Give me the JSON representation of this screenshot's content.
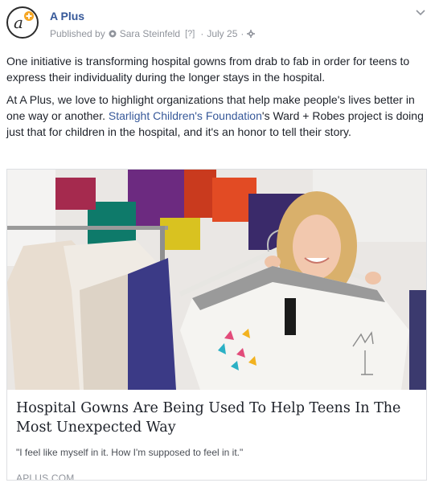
{
  "post": {
    "page_name": "A Plus",
    "published_by_label": "Published by",
    "author": "Sara Steinfeld",
    "info_marker": "[?]",
    "separator": "·",
    "date": "July 25",
    "icons": {
      "avatar": "a-plus-logo-icon",
      "author": "settings-gear-icon",
      "audience": "globe-icon",
      "menu": "chevron-down-icon"
    }
  },
  "text": {
    "p1": "One initiative is transforming hospital gowns from drab to fab in order for teens to express their individuality during the longer stays in the hospital.",
    "p2_before": "At A Plus, we love to highlight organizations that help make people's lives better in one way or another. ",
    "p2_link": "Starlight Children's Foundation",
    "p2_after": "'s Ward + Robes project is doing just that for children in the hospital, and it's an honor to tell their story."
  },
  "card": {
    "title": "Hospital Gowns Are Being Used To Help Teens In The Most Unexpected Way",
    "description": "\"I feel like myself in it. How I'm supposed to feel in it.\"",
    "domain": "APLUS.COM"
  },
  "colors": {
    "link": "#365899",
    "meta": "#90949c",
    "text": "#1d2129"
  }
}
